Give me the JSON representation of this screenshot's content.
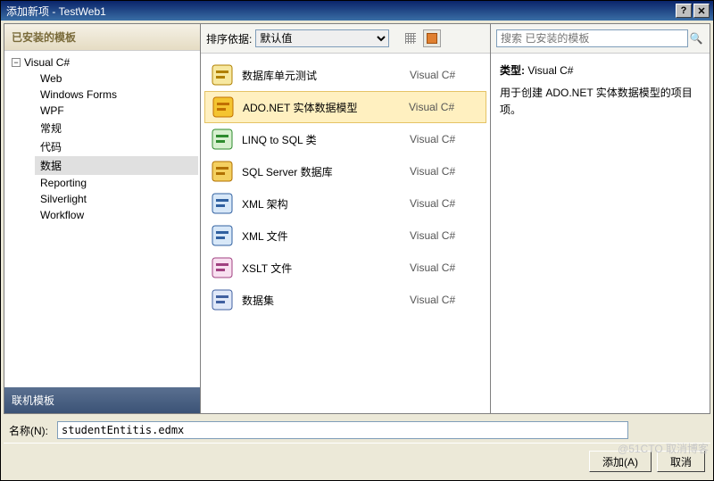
{
  "window": {
    "title": "添加新项 - TestWeb1"
  },
  "left": {
    "installed_header": "已安装的模板",
    "root": "Visual C#",
    "children": [
      "Web",
      "Windows Forms",
      "WPF",
      "常规",
      "代码",
      "数据",
      "Reporting",
      "Silverlight",
      "Workflow"
    ],
    "selected_child": "数据",
    "online_header": "联机模板"
  },
  "center": {
    "sort_label": "排序依据:",
    "sort_value": "默认值",
    "templates": [
      {
        "name": "数据库单元测试",
        "lang": "Visual C#",
        "icon": "db-test",
        "selected": false
      },
      {
        "name": "ADO.NET 实体数据模型",
        "lang": "Visual C#",
        "icon": "ado-edm",
        "selected": true
      },
      {
        "name": "LINQ to SQL 类",
        "lang": "Visual C#",
        "icon": "linq-sql",
        "selected": false
      },
      {
        "name": "SQL Server 数据库",
        "lang": "Visual C#",
        "icon": "sql-db",
        "selected": false
      },
      {
        "name": "XML 架构",
        "lang": "Visual C#",
        "icon": "xml-schema",
        "selected": false
      },
      {
        "name": "XML 文件",
        "lang": "Visual C#",
        "icon": "xml-file",
        "selected": false
      },
      {
        "name": "XSLT 文件",
        "lang": "Visual C#",
        "icon": "xslt-file",
        "selected": false
      },
      {
        "name": "数据集",
        "lang": "Visual C#",
        "icon": "dataset",
        "selected": false
      }
    ]
  },
  "right": {
    "search_placeholder": "搜索 已安装的模板",
    "type_label": "类型:",
    "type_value": "Visual C#",
    "description": "用于创建 ADO.NET 实体数据模型的项目项。"
  },
  "footer": {
    "name_label": "名称(N):",
    "name_value": "studentEntitis.edmx",
    "add_button": "添加(A)",
    "cancel_button": "取消"
  },
  "icons": {
    "db-test": {
      "bg": "#f7e8a0",
      "fg": "#b08000"
    },
    "ado-edm": {
      "bg": "#f4c430",
      "fg": "#c07000"
    },
    "linq-sql": {
      "bg": "#d8f0d0",
      "fg": "#2e8b2e"
    },
    "sql-db": {
      "bg": "#f4d060",
      "fg": "#b07000"
    },
    "xml-schema": {
      "bg": "#d8e8f8",
      "fg": "#3060a0"
    },
    "xml-file": {
      "bg": "#d8e8f8",
      "fg": "#3060a0"
    },
    "xslt-file": {
      "bg": "#f8e0f0",
      "fg": "#a04080"
    },
    "dataset": {
      "bg": "#e0e8f8",
      "fg": "#4060a0"
    }
  },
  "watermark": "@51CTO 取消博客"
}
